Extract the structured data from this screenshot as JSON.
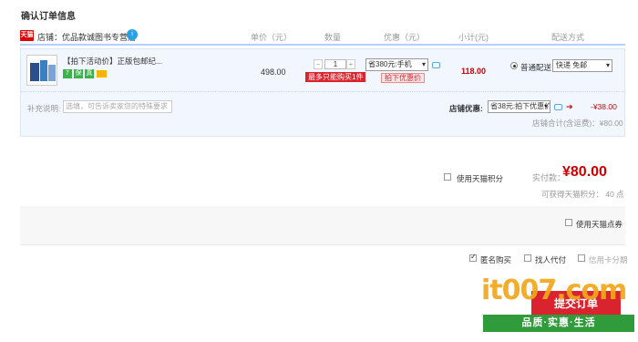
{
  "page": {
    "title": "确认订单信息"
  },
  "shop": {
    "badge": "天猫",
    "name": "店铺：优品款诚图书专营店",
    "chat_icon": "chat-bubble-icon"
  },
  "columns": {
    "price": "单价（元）",
    "qty": "数量",
    "discount": "优惠（元）",
    "subtotal": "小计(元)",
    "shipping": "配送方式"
  },
  "item": {
    "title": "【拍下活动价】正版包邮纪...",
    "service_icons": [
      "7",
      "保",
      "真"
    ],
    "price": "498.00",
    "qty": "1",
    "qty_minus": "−",
    "qty_plus": "+",
    "limit_tip": "最多只能购买1件",
    "discount_select": "省380元:手机",
    "promo_tag": "拍下优惠价",
    "subtotal": "118.00",
    "shipping_option": "普通配送",
    "shipping_select": "快递 免邮"
  },
  "note": {
    "label": "补充说明:",
    "placeholder": "选填，可告诉卖家您的特殊要求"
  },
  "store_discount": {
    "label": "店铺优惠:",
    "select": "省38元:拍下优惠价",
    "amount": "-¥38.00",
    "total": "店铺合计(含运费)：¥80.00"
  },
  "summary": {
    "points_label": "使用天猫积分",
    "pay_label": "实付款：",
    "pay_amount": "¥80.00",
    "earn_label": "可获得天猫积分：  40 点"
  },
  "tmall_coupon": {
    "label": "使用天猫点券"
  },
  "options": {
    "anonymous": "匿名购买",
    "anonymous_checked": true,
    "proxy": "找人代付",
    "installment": "信用卡分期"
  },
  "submit": {
    "label": "提交订单"
  },
  "watermark": {
    "logo": "it007.com",
    "slogan": "品质·实惠·生活"
  },
  "colors": {
    "accent": "#d9232e",
    "price_red": "#cc0000",
    "tmall_red": "#dd0000",
    "row_bg": "#f2f7ff"
  }
}
